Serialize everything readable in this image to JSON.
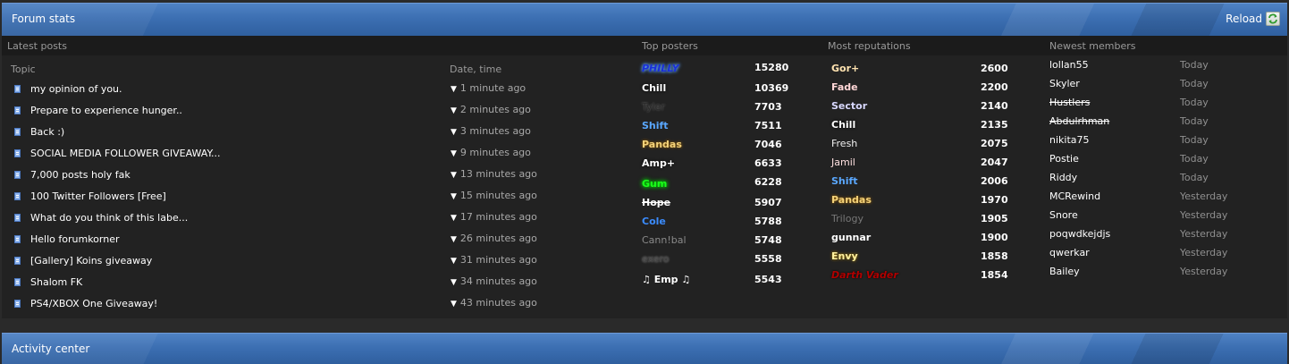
{
  "forum_stats": {
    "title": "Forum stats",
    "reload_label": "Reload"
  },
  "columns": {
    "latest_posts": "Latest posts",
    "top_posters": "Top posters",
    "most_reputations": "Most reputations",
    "newest_members": "Newest members",
    "topic": "Topic",
    "date_time": "Date, time"
  },
  "latest_posts": [
    {
      "topic": "my opinion of you.",
      "time": "1 minute ago"
    },
    {
      "topic": "Prepare to experience hunger..",
      "time": "2 minutes ago"
    },
    {
      "topic": "Back :)",
      "time": "3 minutes ago"
    },
    {
      "topic": "SOCIAL MEDIA FOLLOWER GIVEAWAY...",
      "time": "9 minutes ago"
    },
    {
      "topic": "7,000 posts holy fak",
      "time": "13 minutes ago"
    },
    {
      "topic": "100 Twitter Followers [Free]",
      "time": "15 minutes ago"
    },
    {
      "topic": "What do you think of this labe...",
      "time": "17 minutes ago"
    },
    {
      "topic": "Hello forumkorner",
      "time": "26 minutes ago"
    },
    {
      "topic": "[Gallery] Koins giveaway",
      "time": "31 minutes ago"
    },
    {
      "topic": "Shalom FK",
      "time": "34 minutes ago"
    },
    {
      "topic": "PS4/XBOX One Giveaway!",
      "time": "43 minutes ago"
    }
  ],
  "top_posters": [
    {
      "name": "PHILLY",
      "count": "15280"
    },
    {
      "name": "Chill",
      "count": "10369"
    },
    {
      "name": "Tyler",
      "count": "7703"
    },
    {
      "name": "Shift",
      "count": "7511"
    },
    {
      "name": "Pandas",
      "count": "7046"
    },
    {
      "name": "Amp+",
      "count": "6633"
    },
    {
      "name": "Gum",
      "count": "6228"
    },
    {
      "name": "Hope",
      "count": "5907"
    },
    {
      "name": "Cole",
      "count": "5788"
    },
    {
      "name": "Cann!bal",
      "count": "5748"
    },
    {
      "name": "exero",
      "count": "5558"
    },
    {
      "name": "♫ Emp ♫",
      "count": "5543"
    }
  ],
  "most_reputations": [
    {
      "name": "Gor+",
      "count": "2600"
    },
    {
      "name": "Fade",
      "count": "2200"
    },
    {
      "name": "Sector",
      "count": "2140"
    },
    {
      "name": "Chill",
      "count": "2135"
    },
    {
      "name": "Fresh",
      "count": "2075"
    },
    {
      "name": "Jamil",
      "count": "2047"
    },
    {
      "name": "Shift",
      "count": "2006"
    },
    {
      "name": "Pandas",
      "count": "1970"
    },
    {
      "name": "Trilogy",
      "count": "1905"
    },
    {
      "name": "gunnar",
      "count": "1900"
    },
    {
      "name": "Envy",
      "count": "1858"
    },
    {
      "name": "Darth Vader",
      "count": "1854"
    }
  ],
  "newest_members": [
    {
      "name": "lollan55",
      "when": "Today"
    },
    {
      "name": "Skyler",
      "when": "Today"
    },
    {
      "name": "Hustlers",
      "when": "Today"
    },
    {
      "name": "Abdulrhman",
      "when": "Today"
    },
    {
      "name": "nikita75",
      "when": "Today"
    },
    {
      "name": "Postie",
      "when": "Today"
    },
    {
      "name": "Riddy",
      "when": "Today"
    },
    {
      "name": "MCRewind",
      "when": "Yesterday"
    },
    {
      "name": "Snore",
      "when": "Yesterday"
    },
    {
      "name": "poqwdkejdjs",
      "when": "Yesterday"
    },
    {
      "name": "qwerkar",
      "when": "Yesterday"
    },
    {
      "name": "Bailey",
      "when": "Yesterday"
    }
  ],
  "activity_center": {
    "title": "Activity center"
  },
  "colors": {
    "header_blue": "#3c6fb2",
    "panel_bg": "#222222",
    "column_header_bg": "#1b1b1b"
  },
  "icons": {
    "reload": "reload-icon",
    "topic": "page-icon",
    "arrow": "arrow-down-icon"
  }
}
